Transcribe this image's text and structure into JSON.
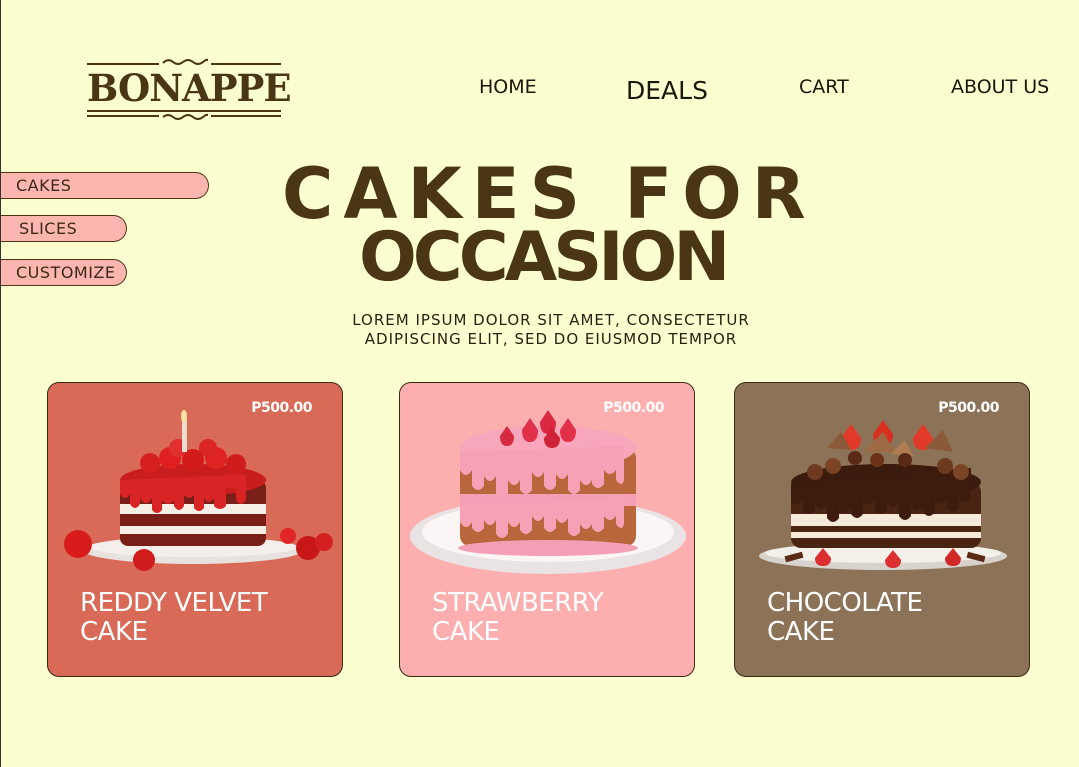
{
  "brand": {
    "name": "BONAPPE"
  },
  "nav": {
    "home": "HOME",
    "deals": "DEALS",
    "cart": "CART",
    "about": "ABOUT US"
  },
  "sidebar": {
    "items": [
      {
        "label": "CAKES"
      },
      {
        "label": "SLICES"
      },
      {
        "label": "CUSTOMIZE"
      }
    ]
  },
  "hero": {
    "line1": "CAKES FOR",
    "line2": "OCCASION",
    "sub_line1": "LOREM IPSUM DOLOR SIT AMET, CONSECTETUR",
    "sub_line2": "ADIPISCING ELIT, SED DO EIUSMOD TEMPOR"
  },
  "products": [
    {
      "price": "P500.00",
      "name_line1": "REDDY VELVET",
      "name_line2": "CAKE",
      "color": "#d96a58"
    },
    {
      "price": "P500.00",
      "name_line1": "STRAWBERRY",
      "name_line2": "CAKE",
      "color": "#fdaeae"
    },
    {
      "price": "P500.00",
      "name_line1": "CHOCOLATE",
      "name_line2": "CAKE",
      "color": "#8c7358"
    }
  ],
  "colors": {
    "background": "#fbffd0",
    "brand_brown": "#4a3515",
    "pill": "#fdb5b0"
  }
}
